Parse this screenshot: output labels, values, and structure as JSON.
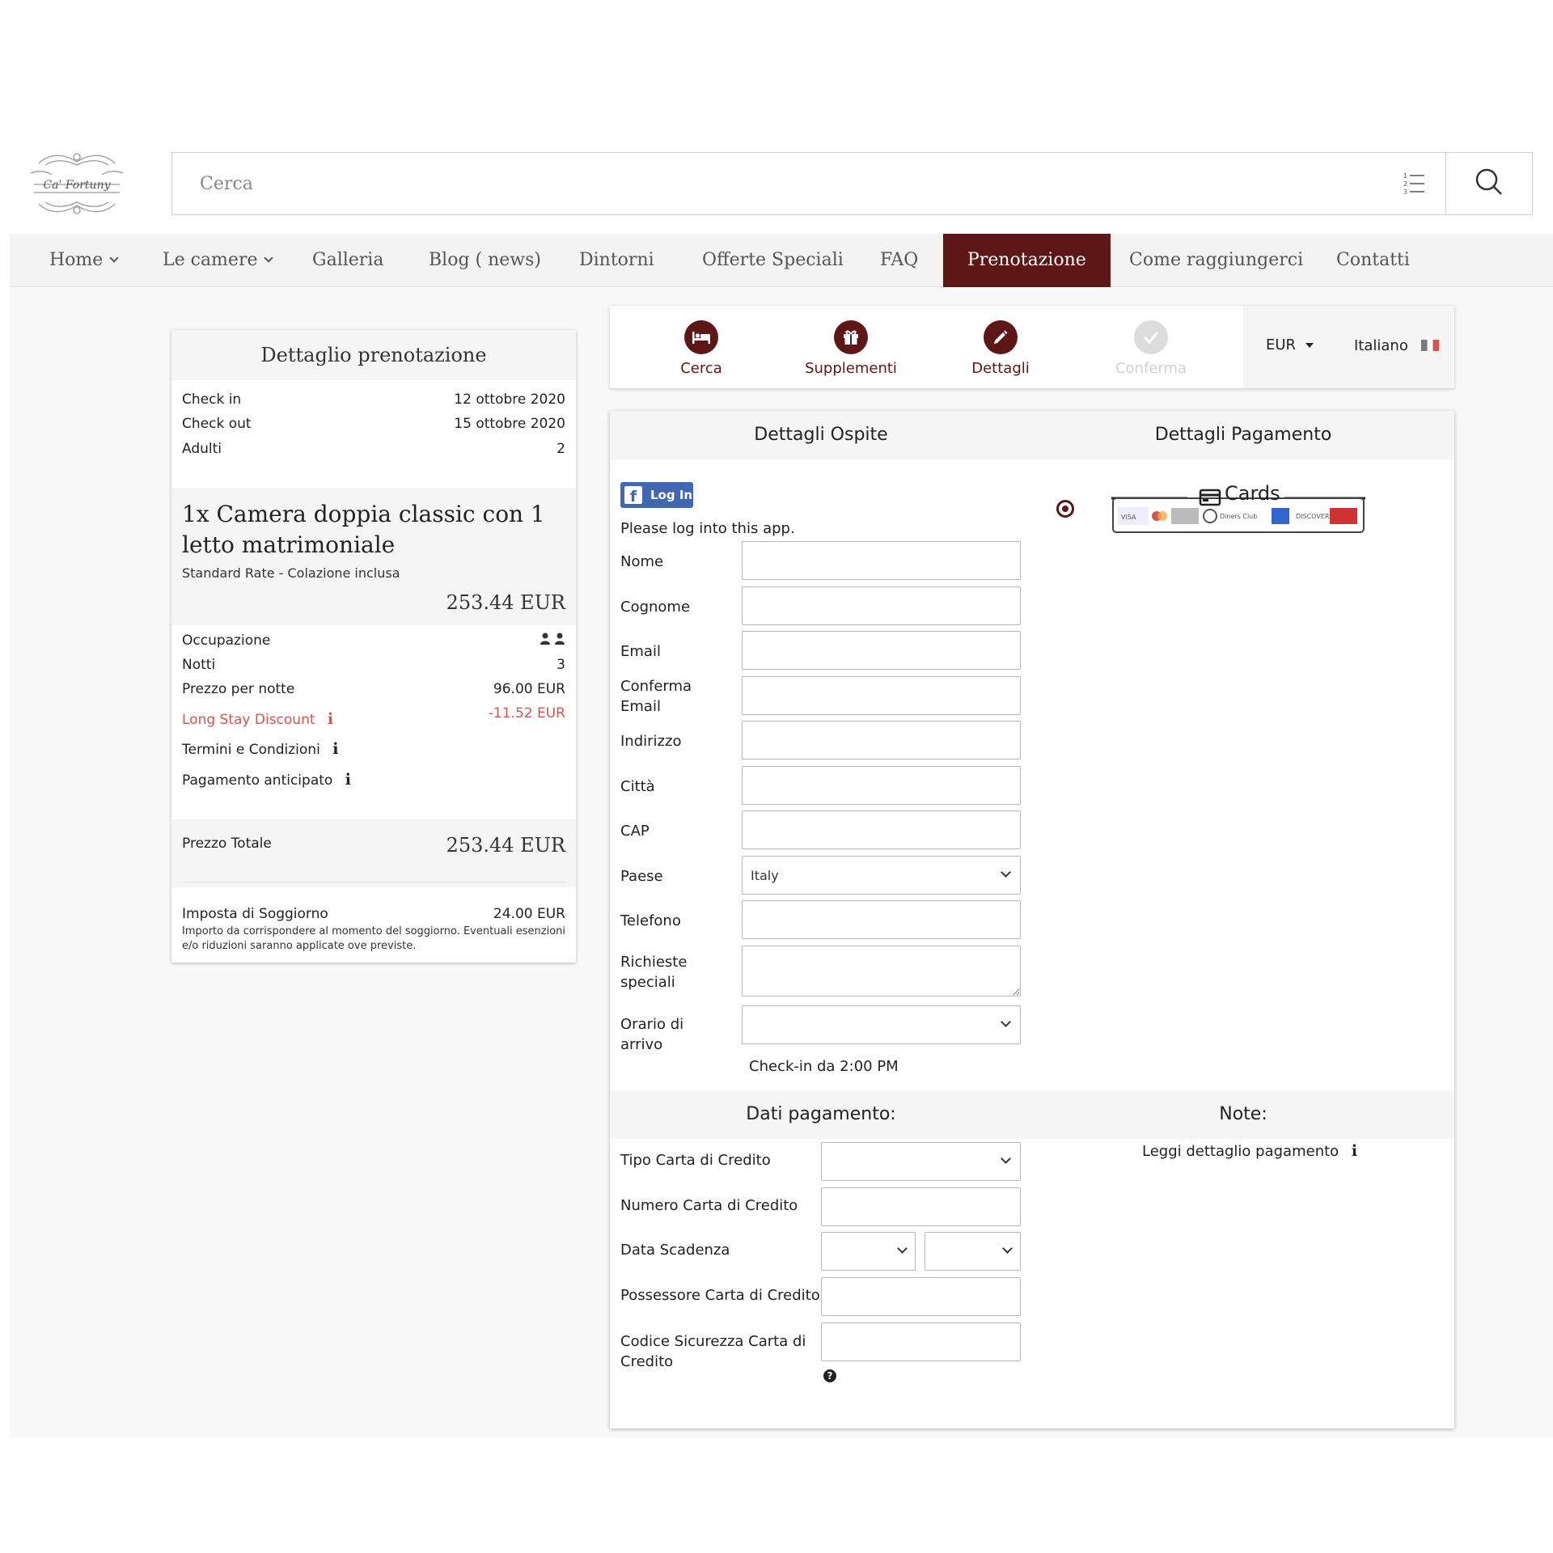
{
  "header": {
    "logo_text": "Ca' Fortuny",
    "search_placeholder": "Cerca"
  },
  "nav": {
    "items": [
      {
        "label": "Home"
      },
      {
        "label": "Le camere"
      },
      {
        "label": "Galleria"
      },
      {
        "label": "Blog ( news)"
      },
      {
        "label": "Dintorni"
      },
      {
        "label": "Offerte Speciali"
      },
      {
        "label": "FAQ"
      },
      {
        "label": "Prenotazione"
      },
      {
        "label": "Come raggiungerci"
      },
      {
        "label": "Contatti"
      }
    ],
    "active_color": "#5e1717"
  },
  "summary": {
    "title": "Dettaglio prenotazione",
    "check_in_label": "Check in",
    "check_in_value": "12 ottobre 2020",
    "check_out_label": "Check out",
    "check_out_value": "15 ottobre 2020",
    "adults_label": "Adulti",
    "adults_value": "2",
    "room_name": "1x Camera doppia classic con 1 letto matrimoniale",
    "room_rate": "Standard Rate - Colazione inclusa",
    "room_price": "253.44 EUR",
    "occupancy_label": "Occupazione",
    "nights_label": "Notti",
    "nights_value": "3",
    "price_per_night_label": "Prezzo per notte",
    "price_per_night_value": "96.00 EUR",
    "discount_label": "Long Stay Discount",
    "discount_value": "-11.52 EUR",
    "discount_color": "#d9534f",
    "terms_label": "Termini e Condizioni",
    "prepay_label": "Pagamento anticipato",
    "total_label": "Prezzo Totale",
    "total_value": "253.44 EUR",
    "tax_label": "Imposta di Soggiorno",
    "tax_value": "24.00 EUR",
    "tax_note": "Importo da corrispondere al momento del soggiorno. Eventuali esenzioni e/o riduzioni saranno applicate ove previste."
  },
  "steps": {
    "items": [
      {
        "label": "Cerca",
        "icon": "bed-icon"
      },
      {
        "label": "Supplementi",
        "icon": "gift-icon"
      },
      {
        "label": "Dettagli",
        "icon": "pencil-icon"
      },
      {
        "label": "Conferma",
        "icon": "check-icon"
      }
    ],
    "currency": "EUR",
    "language": "Italiano"
  },
  "guest": {
    "heading": "Dettagli Ospite",
    "fb_login": "Log In",
    "fb_prompt": "Please log into this app.",
    "nome": "Nome",
    "cognome": "Cognome",
    "email": "Email",
    "conferma_email": "Conferma Email",
    "indirizzo": "Indirizzo",
    "citta": "Città",
    "cap": "CAP",
    "paese": "Paese",
    "paese_value": "Italy",
    "telefono": "Telefono",
    "richieste": "Richieste speciali",
    "orario": "Orario di arrivo",
    "checkin_note": "Check-in da 2:00 PM"
  },
  "payment_details": {
    "heading": "Dettagli Pagamento",
    "cards_label": "Cards"
  },
  "payment": {
    "heading": "Dati pagamento:",
    "card_type": "Tipo Carta di Credito",
    "card_number": "Numero Carta di Credito",
    "expiry": "Data Scadenza",
    "holder": "Possessore Carta di Credito",
    "cvv": "Codice Sicurezza Carta di Credito"
  },
  "notes": {
    "heading": "Note:",
    "read_payment": "Leggi dettaglio pagamento"
  }
}
